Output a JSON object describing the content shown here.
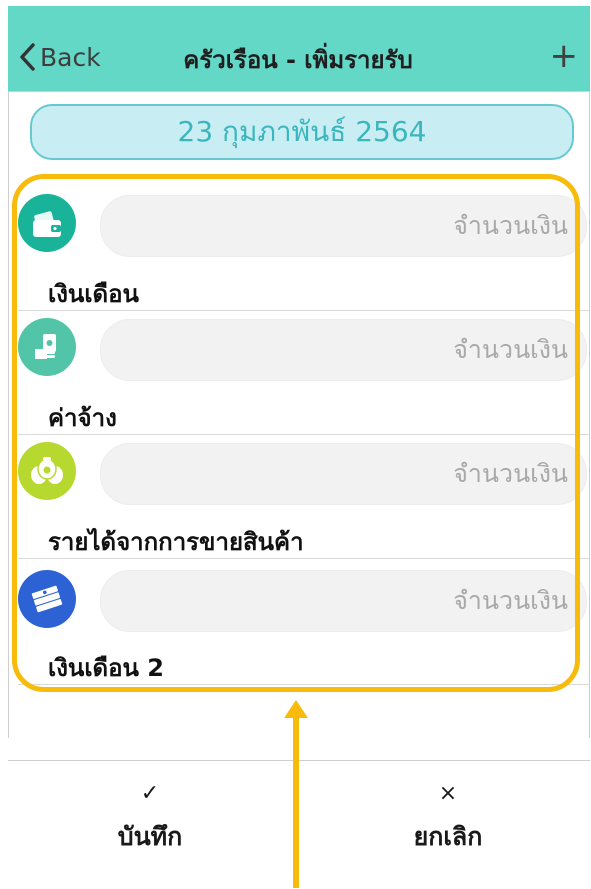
{
  "header": {
    "back_label": "Back",
    "title": "ครัวเรือน - เพิ่มรายรับ",
    "add_symbol": "+"
  },
  "date": {
    "label": "23 กุมภาพันธ์ 2564"
  },
  "items": [
    {
      "label": "เงินเดือน",
      "placeholder": "จำนวนเงิน",
      "icon": "wallet-icon",
      "icon_color": "#19b39a"
    },
    {
      "label": "ค่าจ้าง",
      "placeholder": "จำนวนเงิน",
      "icon": "money-hand-icon",
      "icon_color": "#52c4a7"
    },
    {
      "label": "รายได้จากการขายสินค้า",
      "placeholder": "จำนวนเงิน",
      "icon": "money-bags-icon",
      "icon_color": "#b7d92f"
    },
    {
      "label": "เงินเดือน 2",
      "placeholder": "จำนวนเงิน",
      "icon": "cash-stack-icon",
      "icon_color": "#2c62d3"
    }
  ],
  "actions": {
    "save_symbol": "✓",
    "save_label": "บันทึก",
    "cancel_symbol": "×",
    "cancel_label": "ยกเลิก"
  },
  "colors": {
    "header": "#64d8c7",
    "date_pill_bg": "#c8eef3",
    "date_pill_text": "#3bb6bd",
    "highlight": "#f8bb0b"
  }
}
